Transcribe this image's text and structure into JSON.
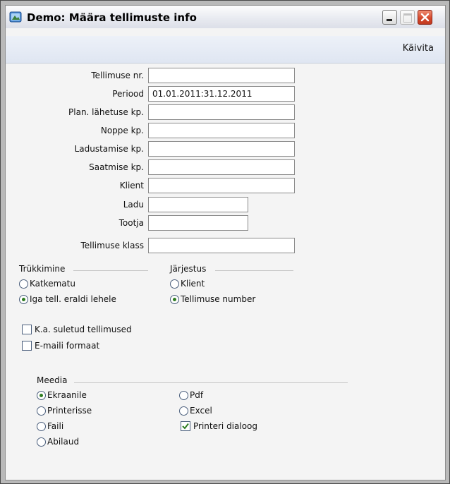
{
  "window": {
    "title": "Demo: Määra tellimuste info"
  },
  "toolbar": {
    "run_label": "Käivita"
  },
  "fields": [
    {
      "label": "Tellimuse nr.",
      "value": ""
    },
    {
      "label": "Periood",
      "value": "01.01.2011:31.12.2011"
    },
    {
      "label": "Plan. lähetuse kp.",
      "value": ""
    },
    {
      "label": "Noppe kp.",
      "value": ""
    },
    {
      "label": "Ladustamise kp.",
      "value": ""
    },
    {
      "label": "Saatmise kp.",
      "value": ""
    },
    {
      "label": "Klient",
      "value": ""
    },
    {
      "label": "Ladu",
      "value": ""
    },
    {
      "label": "Tootja",
      "value": ""
    },
    {
      "label": "Tellimuse klass",
      "value": ""
    }
  ],
  "printing": {
    "title": "Trükkimine",
    "options": [
      {
        "label": "Katkematu",
        "selected": false
      },
      {
        "label": "Iga tell. eraldi lehele",
        "selected": true
      }
    ]
  },
  "sorting": {
    "title": "Järjestus",
    "options": [
      {
        "label": "Klient",
        "selected": false
      },
      {
        "label": "Tellimuse number",
        "selected": true
      }
    ]
  },
  "checkboxes": [
    {
      "label": "K.a. suletud tellimused",
      "checked": false
    },
    {
      "label": "E-maili formaat",
      "checked": false
    }
  ],
  "media": {
    "title": "Meedia",
    "options": [
      {
        "label": "Ekraanile",
        "selected": true
      },
      {
        "label": "Printerisse",
        "selected": false
      },
      {
        "label": "Faili",
        "selected": false
      },
      {
        "label": "Abilaud",
        "selected": false
      },
      {
        "label": "Pdf",
        "selected": false
      },
      {
        "label": "Excel",
        "selected": false
      }
    ],
    "printer_dialog": {
      "label": "Printeri dialoog",
      "checked": true
    }
  },
  "colors": {
    "accent": "#2e7d20",
    "close": "#d54a2d",
    "toolbar": "#e3e9f4"
  }
}
